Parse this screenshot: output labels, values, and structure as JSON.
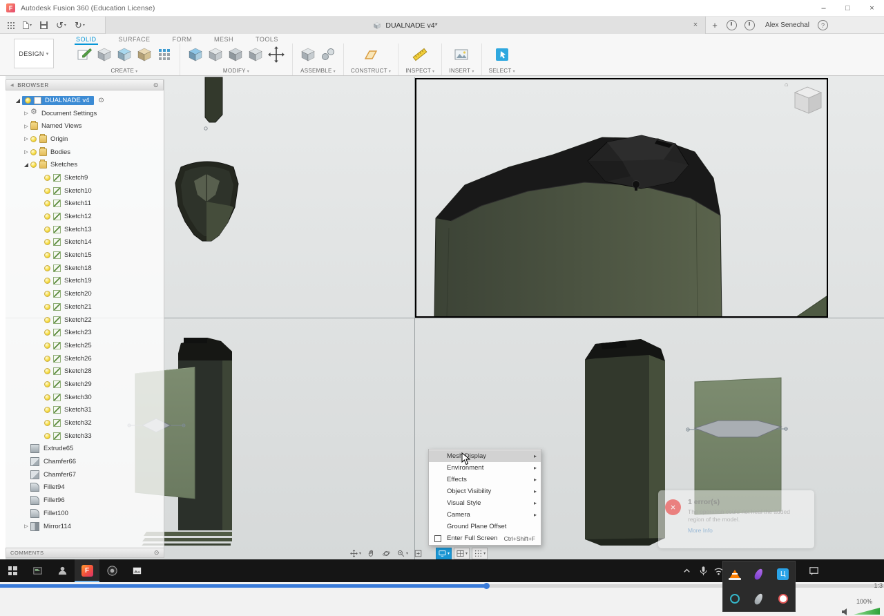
{
  "window": {
    "title": "Autodesk Fusion 360 (Education License)",
    "minimize": "–",
    "maximize": "□",
    "close": "×"
  },
  "tabbar": {
    "document_tab": "DUALNADE v4*",
    "close_tab": "×",
    "new_tab": "+",
    "user_name": "Alex Senechal",
    "help": "?"
  },
  "ribbon": {
    "workspace": "DESIGN",
    "tabs": [
      {
        "label": "SOLID",
        "active": true
      },
      {
        "label": "SURFACE"
      },
      {
        "label": "FORM"
      },
      {
        "label": "MESH"
      },
      {
        "label": "TOOLS"
      }
    ],
    "groups": [
      "CREATE",
      "MODIFY",
      "ASSEMBLE",
      "CONSTRUCT",
      "INSPECT",
      "INSERT",
      "SELECT"
    ]
  },
  "browser": {
    "header": "BROWSER",
    "root_label": "DUALNADE v4",
    "items": [
      {
        "label": "Document Settings",
        "arrow": "collapsed",
        "icon": "gear"
      },
      {
        "label": "Named Views",
        "arrow": "collapsed",
        "icon": "folder"
      },
      {
        "label": "Origin",
        "arrow": "collapsed",
        "bulb": true,
        "icon": "folder"
      },
      {
        "label": "Bodies",
        "arrow": "collapsed",
        "bulb": true,
        "icon": "folder"
      },
      {
        "label": "Sketches",
        "arrow": "expanded",
        "bulb": true,
        "icon": "folder"
      }
    ],
    "sketches": [
      "Sketch9",
      "Sketch10",
      "Sketch11",
      "Sketch12",
      "Sketch13",
      "Sketch14",
      "Sketch15",
      "Sketch18",
      "Sketch19",
      "Sketch20",
      "Sketch21",
      "Sketch22",
      "Sketch23",
      "Sketch25",
      "Sketch26",
      "Sketch28",
      "Sketch29",
      "Sketch30",
      "Sketch31",
      "Sketch32",
      "Sketch33"
    ],
    "features": [
      {
        "label": "Extrude65",
        "icon": "extrude"
      },
      {
        "label": "Chamfer66",
        "icon": "chamfer"
      },
      {
        "label": "Chamfer67",
        "icon": "chamfer"
      },
      {
        "label": "Fillet94",
        "icon": "fillet"
      },
      {
        "label": "Fillet96",
        "icon": "fillet"
      },
      {
        "label": "Fillet100",
        "icon": "fillet"
      },
      {
        "label": "Mirror114",
        "icon": "mirror",
        "arrow": "collapsed"
      }
    ],
    "comments_label": "COMMENTS"
  },
  "context_menu": {
    "items": [
      {
        "label": "Mesh Display",
        "submenu": true,
        "highlighted": true
      },
      {
        "label": "Environment",
        "submenu": true
      },
      {
        "label": "Effects",
        "submenu": true
      },
      {
        "label": "Object Visibility",
        "submenu": true
      },
      {
        "label": "Visual Style",
        "submenu": true
      },
      {
        "label": "Camera",
        "submenu": true
      },
      {
        "label": "Ground Plane Offset",
        "sep_before": true
      },
      {
        "label": "Enter Full Screen",
        "shortcut": "Ctrl+Shift+F",
        "icon": "fullscreen",
        "sep_before": true
      }
    ]
  },
  "error_toast": {
    "title": "1 error(s)",
    "message": "The operation could not heal the added region of the model.",
    "link": "More Info"
  },
  "player": {
    "time": "1:3",
    "volume": "100%"
  },
  "icons": {
    "options_dot": "⊙",
    "collapse_panel": "◀",
    "undo": "↺",
    "redo": "↻"
  }
}
